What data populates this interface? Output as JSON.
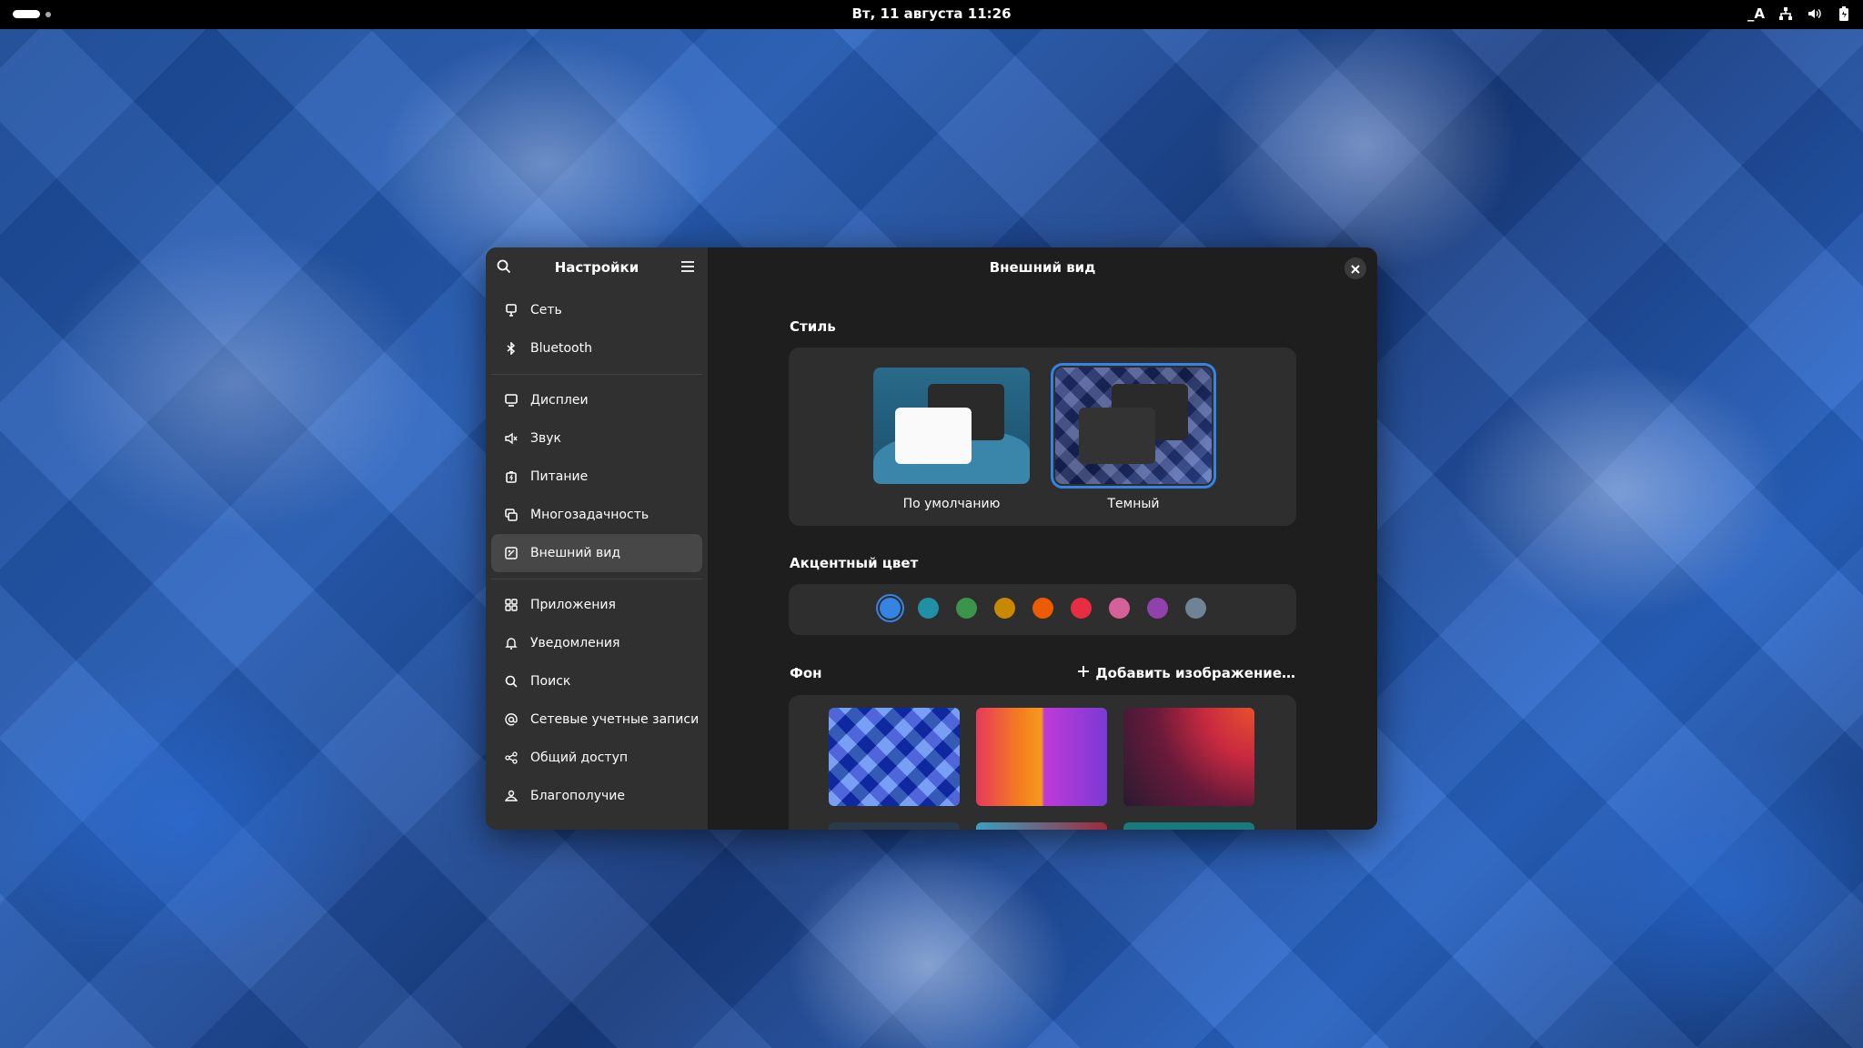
{
  "topbar": {
    "clock": "Вт, 11 августа  11:26",
    "input_method": "_A"
  },
  "window": {
    "sidebar_title": "Настройки",
    "content_title": "Внешний вид"
  },
  "nav": [
    {
      "label": "Сеть",
      "icon": "network-icon"
    },
    {
      "label": "Bluetooth",
      "icon": "bluetooth-icon"
    },
    {
      "label": "Дисплеи",
      "icon": "display-icon"
    },
    {
      "label": "Звук",
      "icon": "sound-icon"
    },
    {
      "label": "Питание",
      "icon": "power-icon"
    },
    {
      "label": "Многозадачность",
      "icon": "multitasking-icon"
    },
    {
      "label": "Внешний вид",
      "icon": "appearance-icon"
    },
    {
      "label": "Приложения",
      "icon": "apps-icon"
    },
    {
      "label": "Уведомления",
      "icon": "bell-icon"
    },
    {
      "label": "Поиск",
      "icon": "search-icon"
    },
    {
      "label": "Сетевые учетные записи",
      "icon": "online-accounts-icon"
    },
    {
      "label": "Общий доступ",
      "icon": "share-icon"
    },
    {
      "label": "Благополучие",
      "icon": "wellbeing-icon"
    }
  ],
  "style": {
    "label": "Стиль",
    "options": [
      {
        "label": "По умолчанию"
      },
      {
        "label": "Темный",
        "selected": true
      }
    ]
  },
  "accent": {
    "label": "Акцентный цвет",
    "colors": [
      "#3584e4",
      "#2190a4",
      "#3a944a",
      "#c88800",
      "#ed5b00",
      "#e62d42",
      "#d56199",
      "#9141ac",
      "#6f8396"
    ],
    "selected_index": 0
  },
  "background": {
    "label": "Фон",
    "add_label": "Добавить изображение…"
  }
}
